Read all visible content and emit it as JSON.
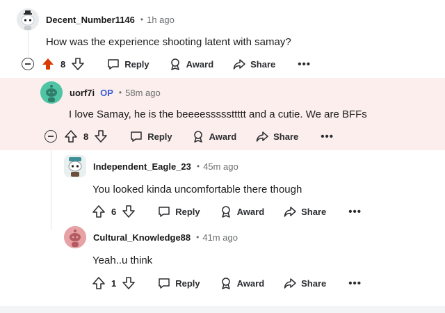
{
  "comments": [
    {
      "username": "Decent_Number1146",
      "time": "1h ago",
      "text": "How was the experience shooting latent with samay?",
      "score": "8",
      "upvoted": true,
      "reply_label": "Reply",
      "award_label": "Award",
      "share_label": "Share"
    },
    {
      "username": "uorf7i",
      "op_badge": "OP",
      "time": "58m ago",
      "text": "I love Samay, he is the beeeesssssttttt and a cutie. We are BFFs",
      "score": "8",
      "reply_label": "Reply",
      "award_label": "Award",
      "share_label": "Share"
    },
    {
      "username": "Independent_Eagle_23",
      "time": "45m ago",
      "text": "You looked kinda uncomfortable there though",
      "score": "6",
      "reply_label": "Reply",
      "award_label": "Award",
      "share_label": "Share"
    },
    {
      "username": "Cultural_Knowledge88",
      "time": "41m ago",
      "text": "Yeah..u think",
      "score": "1",
      "reply_label": "Reply",
      "award_label": "Award",
      "share_label": "Share"
    }
  ],
  "separator": "•",
  "more_label": "•••",
  "colors": {
    "upvote_active": "#d93a00",
    "op_badge": "#3a5bd9",
    "highlight_bg": "#fbeeec",
    "avatar_teal": "#4fc5a6",
    "avatar_pink": "#e6a2a5"
  }
}
